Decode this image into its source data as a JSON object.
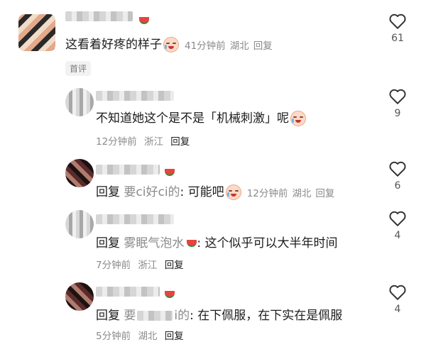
{
  "comments": [
    {
      "text": "这看着好疼的样子",
      "time": "41分钟前",
      "location": "湖北",
      "reply_label": "回复",
      "likes": "61",
      "badge": "首评"
    },
    {
      "text": "不知道她这个是不是「机械刺激」呢",
      "time": "12分钟前",
      "location": "浙江",
      "reply_label": "回复",
      "likes": "9"
    },
    {
      "reply_prefix": "回复",
      "reply_target": "要ci好ci的",
      "text": ": 可能吧",
      "time": "12分钟前",
      "location": "湖北",
      "reply_label": "回复",
      "likes": "6"
    },
    {
      "reply_prefix": "回复",
      "reply_target": "雾眠气泡水",
      "text": ": 这个似乎可以大半年时间",
      "time": "7分钟前",
      "location": "浙江",
      "reply_label": "回复",
      "likes": "4"
    },
    {
      "reply_prefix": "回复",
      "reply_target": "要",
      "reply_target_tail": "i的",
      "text": ": 在下佩服，在下实在是佩服",
      "time": "5分钟前",
      "location": "湖北",
      "reply_label": "回复",
      "likes": "4"
    }
  ],
  "icons": {
    "like": "heart-outline-icon",
    "emoji": "crying-laughing-emoji-icon",
    "badge_decoration": "watermelon-icon"
  },
  "colors": {
    "text": "#1c1c1c",
    "meta": "#8a8a8a",
    "background": "#ffffff"
  }
}
